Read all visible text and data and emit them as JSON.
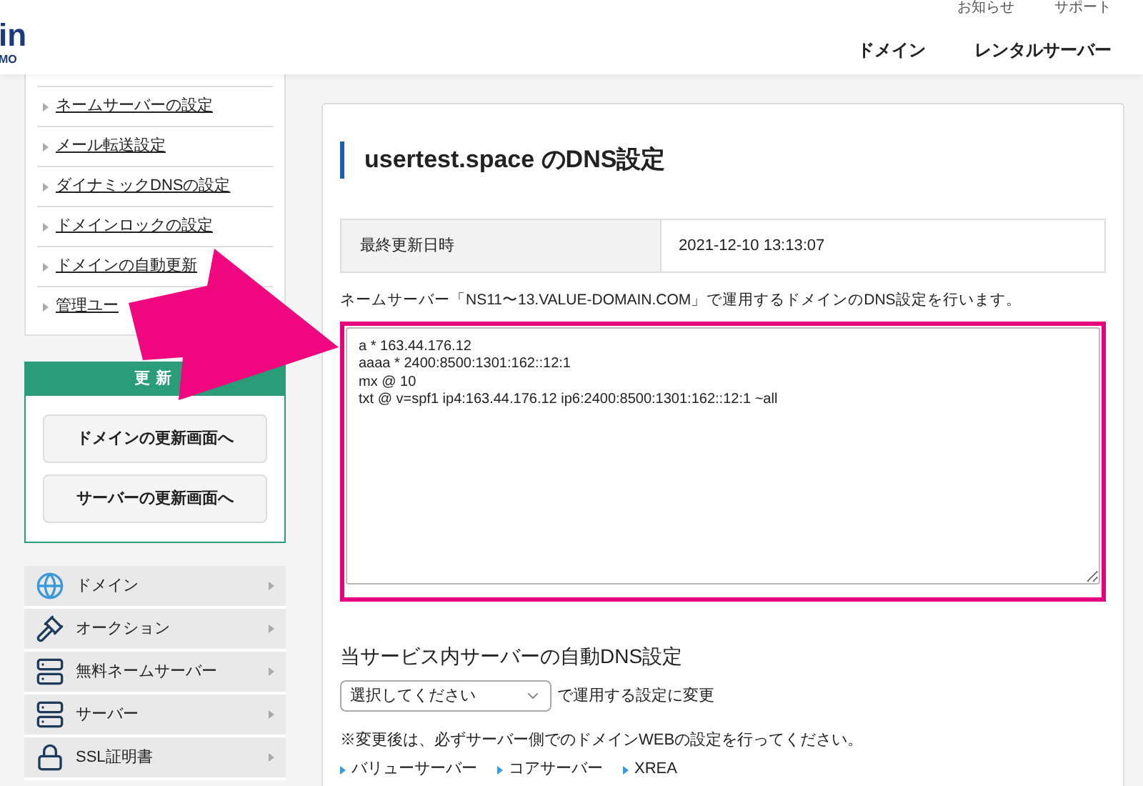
{
  "header": {
    "logo_main": "in",
    "logo_sub": "MO",
    "top_links": [
      "お知らせ",
      "サポート"
    ],
    "nav": [
      "ドメイン",
      "レンタルサーバー"
    ]
  },
  "sidebar": {
    "links": [
      "ネームサーバーの設定",
      "メール転送設定",
      "ダイナミックDNSの設定",
      "ドメインロックの設定",
      "ドメインの自動更新",
      "管理ユー"
    ],
    "renew": {
      "title": "更新",
      "buttons": [
        "ドメインの更新画面へ",
        "サーバーの更新画面へ"
      ]
    },
    "menu": [
      {
        "label": "ドメイン",
        "kind": "globe"
      },
      {
        "label": "オークション",
        "kind": "gavel"
      },
      {
        "label": "無料ネームサーバー",
        "kind": "server"
      },
      {
        "label": "サーバー",
        "kind": "server"
      },
      {
        "label": "SSL証明書",
        "kind": "lock"
      }
    ]
  },
  "main": {
    "title": "usertest.space のDNS設定",
    "updated_label": "最終更新日時",
    "updated_value": "2021-12-10 13:13:07",
    "description": "ネームサーバー「NS11〜13.VALUE-DOMAIN.COM」で運用するドメインのDNS設定を行います。",
    "records": "a * 163.44.176.12\naaaa * 2400:8500:1301:162::12:1\nmx @ 10\ntxt @ v=spf1 ip4:163.44.176.12 ip6:2400:8500:1301:162::12:1 ~all",
    "auto_title": "当サービス内サーバーの自動DNS設定",
    "select_placeholder": "選択してください",
    "select_suffix": "で運用する設定に変更",
    "note": "※変更後は、必ずサーバー側でのドメインWEBの設定を行ってください。",
    "server_links": [
      "バリューサーバー",
      "コアサーバー",
      "XREA"
    ]
  }
}
